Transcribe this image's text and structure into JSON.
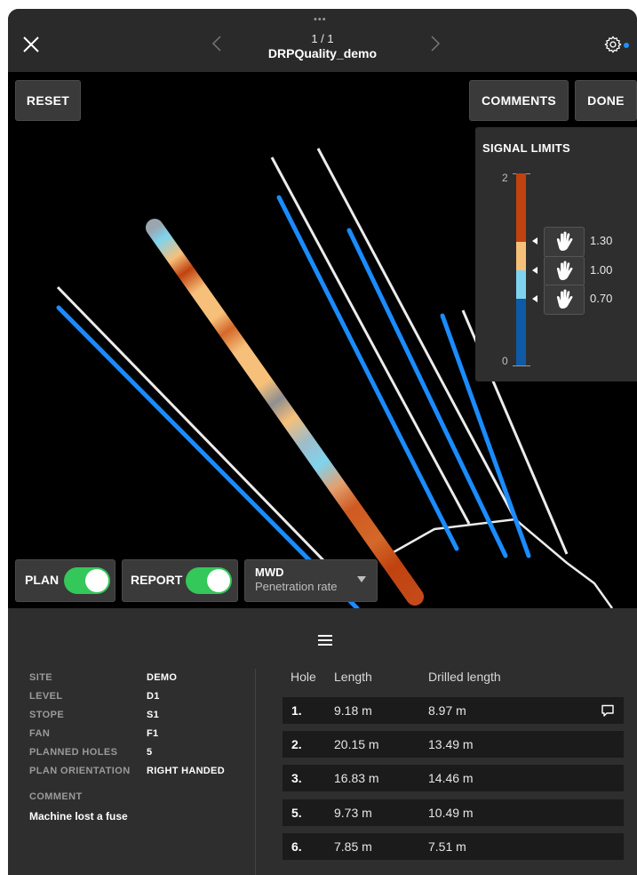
{
  "header": {
    "counter": "1 / 1",
    "title": "DRPQuality_demo"
  },
  "viewport": {
    "reset_label": "RESET",
    "comments_label": "COMMENTS",
    "done_label": "DONE"
  },
  "signal_limits": {
    "title": "SIGNAL LIMITS",
    "max": "2",
    "min": "0",
    "thresholds": [
      "1.30",
      "1.00",
      "0.70"
    ],
    "colors": {
      "high": "#c0420f",
      "mid_high": "#f6c07a",
      "mid_low": "#7fd3ee",
      "low": "#0f5aa6"
    }
  },
  "toggles": {
    "plan_label": "PLAN",
    "plan_on": true,
    "report_label": "REPORT",
    "report_on": true,
    "mwd_title": "MWD",
    "mwd_value": "Penetration rate"
  },
  "info": {
    "rows": [
      {
        "label": "SITE",
        "value": "DEMO"
      },
      {
        "label": "LEVEL",
        "value": "D1"
      },
      {
        "label": "STOPE",
        "value": "S1"
      },
      {
        "label": "FAN",
        "value": "F1"
      },
      {
        "label": "PLANNED HOLES",
        "value": "5"
      },
      {
        "label": "PLAN ORIENTATION",
        "value": "RIGHT HANDED"
      }
    ],
    "comment_label": "COMMENT",
    "comment": "Machine lost a fuse"
  },
  "holes": {
    "headers": {
      "hole": "Hole",
      "length": "Length",
      "drilled": "Drilled length"
    },
    "rows": [
      {
        "hole": "1.",
        "length": "9.18 m",
        "drilled": "8.97 m"
      },
      {
        "hole": "2.",
        "length": "20.15 m",
        "drilled": "13.49 m"
      },
      {
        "hole": "3.",
        "length": "16.83 m",
        "drilled": "14.46 m"
      },
      {
        "hole": "5.",
        "length": "9.73 m",
        "drilled": "10.49 m"
      },
      {
        "hole": "6.",
        "length": "7.85 m",
        "drilled": "7.51 m"
      }
    ]
  },
  "colors": {
    "planned_line": "#ececec",
    "drilled_line": "#1a8cff",
    "toggle_on": "#34c759"
  }
}
